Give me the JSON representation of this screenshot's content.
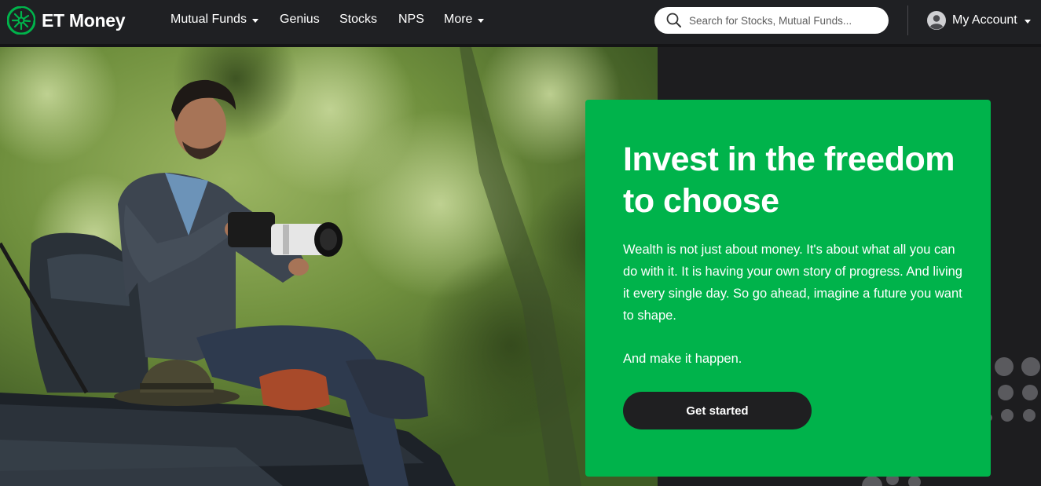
{
  "header": {
    "brand": "ET Money",
    "brand_color": "#00b34b",
    "nav": [
      {
        "label": "Mutual Funds",
        "has_dropdown": true
      },
      {
        "label": "Genius",
        "has_dropdown": false
      },
      {
        "label": "Stocks",
        "has_dropdown": false
      },
      {
        "label": "NPS",
        "has_dropdown": false
      },
      {
        "label": "More",
        "has_dropdown": true
      }
    ],
    "search": {
      "placeholder": "Search for Stocks, Mutual Funds...",
      "value": "",
      "icon": "search-icon"
    },
    "account": {
      "label": "My Account",
      "icon": "user-avatar-icon",
      "has_dropdown": true
    }
  },
  "hero": {
    "image": "man-with-camera-on-jeep-photo",
    "card_color": "#00b34b",
    "title": "Invest in the freedom to choose",
    "body": "Wealth is not just about money. It's about what all you can do with it. It is having your own story of progress. And living it every single day. So go ahead, imagine a future you want to shape.",
    "cta_text": "And make it happen.",
    "button_label": "Get started"
  }
}
